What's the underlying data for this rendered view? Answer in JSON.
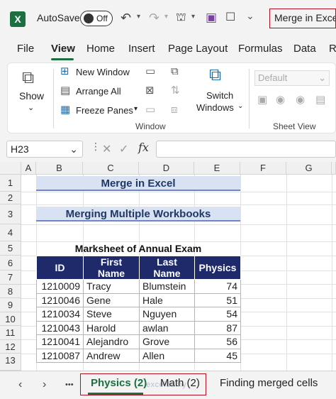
{
  "titlebar": {
    "autosave_label": "AutoSave",
    "autosave_state": "Off",
    "doc_title": "Merge in Excel"
  },
  "ribbon_tabs": [
    "File",
    "View",
    "Home",
    "Insert",
    "Page Layout",
    "Formulas",
    "Data",
    "R"
  ],
  "active_tab": "View",
  "ribbon": {
    "show_label": "Show",
    "window_group": {
      "new_window": "New Window",
      "arrange_all": "Arrange All",
      "freeze_panes": "Freeze Panes",
      "switch_windows_line1": "Switch",
      "switch_windows_line2": "Windows",
      "group_label": "Window"
    },
    "sheet_view_group": {
      "view_select": "Default",
      "group_label": "Sheet View"
    }
  },
  "formula_bar": {
    "name_box": "H23",
    "fx": "fx",
    "formula": ""
  },
  "columns": [
    "A",
    "B",
    "C",
    "D",
    "E",
    "F",
    "G"
  ],
  "rows": [
    "1",
    "2",
    "3",
    "4",
    "5",
    "6",
    "7",
    "8",
    "9",
    "10",
    "11",
    "12",
    "13"
  ],
  "sheet": {
    "title": "Merge in Excel",
    "subtitle": "Merging Multiple Workbooks",
    "table_title": "Marksheet of Annual Exam",
    "headers": [
      "ID",
      "First Name",
      "Last Name",
      "Physics"
    ],
    "rows": [
      [
        "1210009",
        "Tracy",
        "Blumstein",
        "74"
      ],
      [
        "1210046",
        "Gene",
        "Hale",
        "51"
      ],
      [
        "1210034",
        "Steve",
        "Nguyen",
        "54"
      ],
      [
        "1210043",
        "Harold",
        "awlan",
        "87"
      ],
      [
        "1210041",
        "Alejandro",
        "Grove",
        "56"
      ],
      [
        "1210087",
        "Andrew",
        "Allen",
        "45"
      ]
    ]
  },
  "sheet_tabs": {
    "tabs": [
      "Physics (2)",
      "Math (2)",
      "Finding merged cells"
    ],
    "active": "Physics (2)",
    "more": "•••",
    "watermark": "exceldemy"
  },
  "colors": {
    "excel_green": "#1d6f42",
    "banner_fill": "#d9e2f3",
    "header_fill": "#1f2a6b",
    "highlight_red": "#b01020"
  }
}
